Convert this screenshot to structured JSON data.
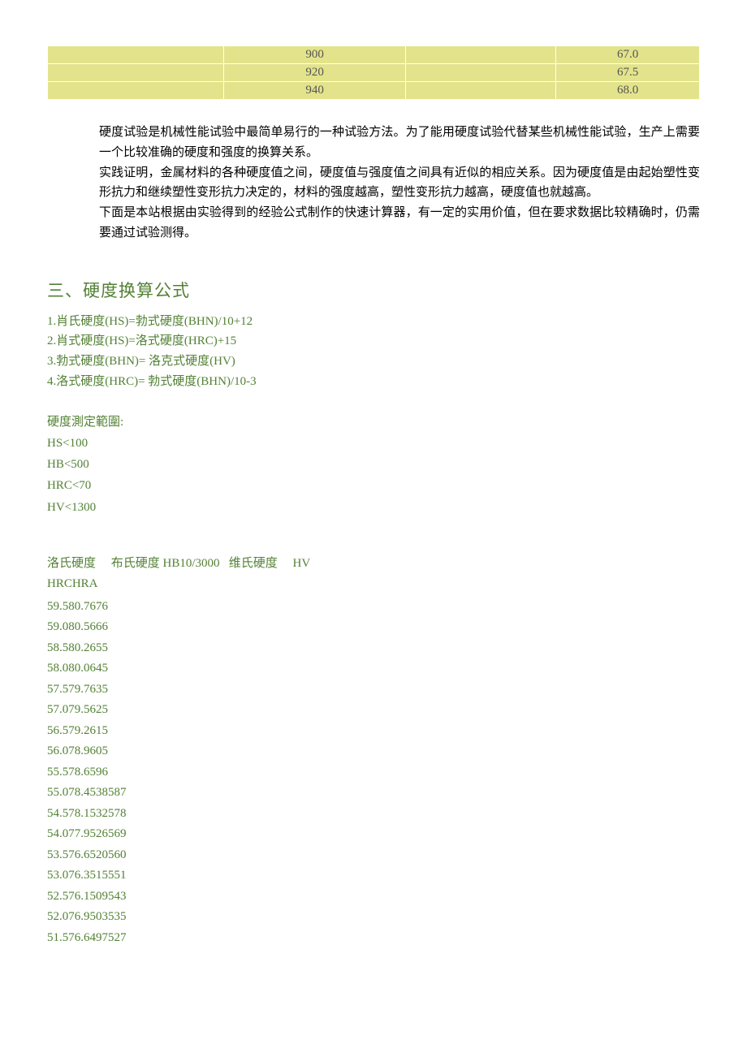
{
  "top_table": {
    "rows": [
      [
        "",
        "900",
        "",
        "67.0"
      ],
      [
        "",
        "920",
        "",
        "67.5"
      ],
      [
        "",
        "940",
        "",
        "68.0"
      ]
    ]
  },
  "paragraphs": {
    "p1": "硬度试验是机械性能试验中最简单易行的一种试验方法。为了能用硬度试验代替某些机械性能试验，生产上需要一个比较准确的硬度和强度的换算关系。",
    "p2": "实践证明，金属材料的各种硬度值之间，硬度值与强度值之间具有近似的相应关系。因为硬度值是由起始塑性变形抗力和继续塑性变形抗力决定的，材料的强度越高，塑性变形抗力越高，硬度值也就越高。",
    "p3": "下面是本站根据由实验得到的经验公式制作的快速计算器，有一定的实用价值，但在要求数据比较精确时，仍需要通过试验测得。"
  },
  "section_title": "三、硬度换算公式",
  "formulas": {
    "f1": "1.肖氏硬度(HS)=勃式硬度(BHN)/10+12",
    "f2": "2.肖式硬度(HS)=洛式硬度(HRC)+15",
    "f3": "3.勃式硬度(BHN)= 洛克式硬度(HV)",
    "f4": "4.洛式硬度(HRC)= 勃式硬度(BHN)/10-3"
  },
  "range": {
    "title": "硬度測定範圍:",
    "r1": "HS<100",
    "r2": "HB<500",
    "r3": "HRC<70",
    "r4": "HV<1300"
  },
  "data_header": {
    "line1_a": "洛氏硬度",
    "line1_b": "布氏硬度 HB10/3000",
    "line1_c": "维氏硬度",
    "line1_d": "HV",
    "line2": "HRCHRA"
  },
  "data_rows": [
    "59.580.7676",
    "59.080.5666",
    "58.580.2655",
    "58.080.0645",
    "57.579.7635",
    "57.079.5625",
    "56.579.2615",
    "56.078.9605",
    "55.578.6596",
    "55.078.4538587",
    "54.578.1532578",
    "54.077.9526569",
    "53.576.6520560",
    "53.076.3515551",
    "52.576.1509543",
    "52.076.9503535",
    "51.576.6497527"
  ]
}
